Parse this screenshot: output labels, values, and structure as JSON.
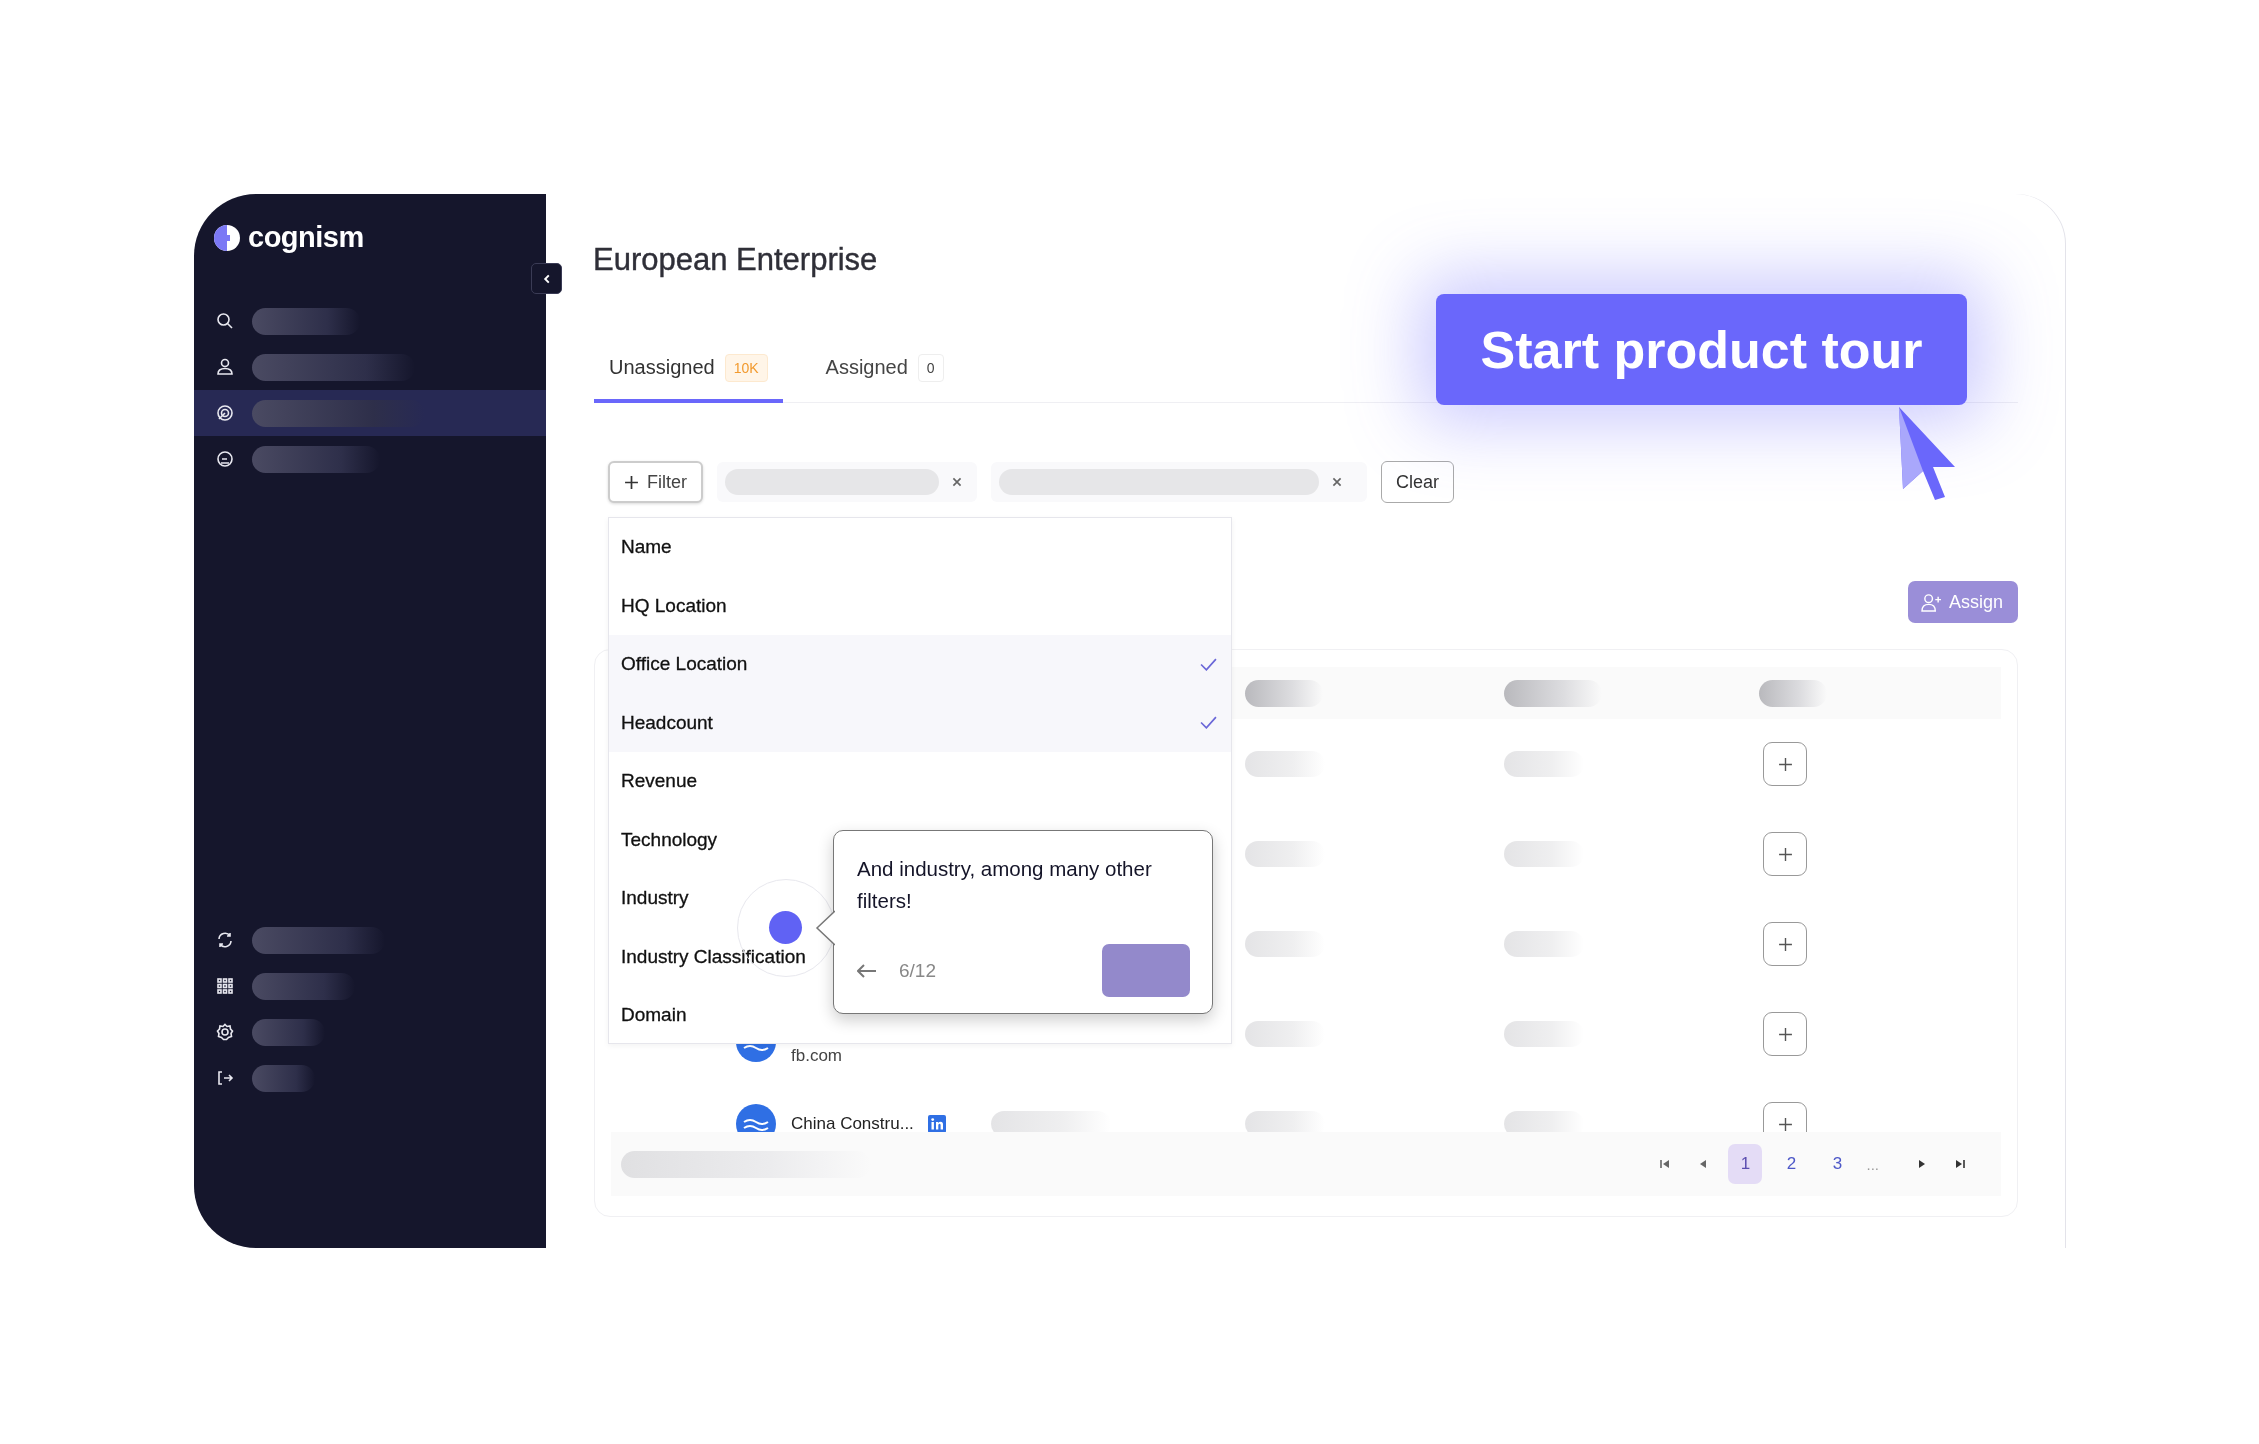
{
  "brand": {
    "name": "cognism"
  },
  "sidebar": {
    "nav_items": [
      {
        "selected": false
      },
      {
        "selected": false
      },
      {
        "selected": true
      },
      {
        "selected": false
      }
    ]
  },
  "page": {
    "title": "European Enterprise"
  },
  "tabs": [
    {
      "label": "Unassigned",
      "count": "10K",
      "selected": true
    },
    {
      "label": "Assigned",
      "count": "0",
      "selected": false
    }
  ],
  "filter_bar": {
    "filter_button": "Filter",
    "clear_button": "Clear"
  },
  "filter_menu": {
    "options": [
      {
        "label": "Name",
        "checked": false
      },
      {
        "label": "HQ Location",
        "checked": false
      },
      {
        "label": "Office Location",
        "checked": true
      },
      {
        "label": "Headcount",
        "checked": true
      },
      {
        "label": "Revenue",
        "checked": false
      },
      {
        "label": "Technology",
        "checked": false
      },
      {
        "label": "Industry",
        "checked": false
      },
      {
        "label": "Industry Classification",
        "checked": false
      },
      {
        "label": "Domain",
        "checked": false
      }
    ]
  },
  "tour": {
    "start_button": "Start product tour",
    "tooltip_text": "And industry, among many other filters!",
    "step": "6/12"
  },
  "toolbar": {
    "assign_button": "Assign"
  },
  "table": {
    "rows": [
      {
        "domain": "fb.com"
      },
      {
        "name": "China Constru..."
      }
    ]
  },
  "pagination": {
    "pages": [
      {
        "label": "1",
        "selected": true
      },
      {
        "label": "2",
        "selected": false
      },
      {
        "label": "3",
        "selected": false
      }
    ],
    "ellipsis": "..."
  }
}
